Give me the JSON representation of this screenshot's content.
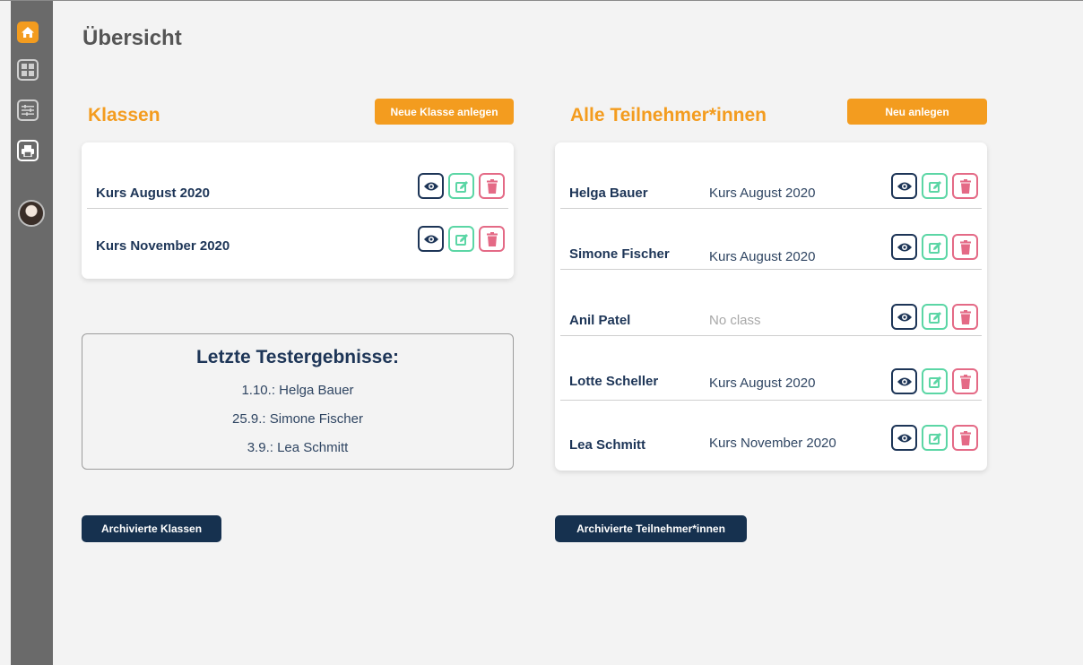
{
  "page": {
    "title": "Übersicht"
  },
  "sidebar": {
    "items": [
      {
        "icon": "home-icon",
        "active": true
      },
      {
        "icon": "dashboard-grid-icon",
        "active": false
      },
      {
        "icon": "settings-sliders-icon",
        "active": false
      },
      {
        "icon": "printer-icon",
        "active": false
      }
    ],
    "avatar_icon": "user-avatar"
  },
  "classes": {
    "title": "Klassen",
    "new_button": "Neue Klasse anlegen",
    "items": [
      {
        "name": "Kurs August 2020"
      },
      {
        "name": "Kurs November 2020"
      }
    ],
    "archive_button": "Archivierte Klassen"
  },
  "participants": {
    "title": "Alle Teilnehmer*innen",
    "new_button": "Neu anlegen",
    "items": [
      {
        "name": "Helga Bauer",
        "course": "Kurs August 2020"
      },
      {
        "name": "Simone Fischer",
        "course": "Kurs August 2020"
      },
      {
        "name": "Anil Patel",
        "course": "No class"
      },
      {
        "name": "Lotte Scheller",
        "course": "Kurs August 2020"
      },
      {
        "name": "Lea Schmitt",
        "course": "Kurs November 2020"
      }
    ],
    "archive_button": "Archivierte Teilnehmer*innen"
  },
  "results": {
    "title": "Letzte Testergebnisse:",
    "entries": [
      "1.10.: Helga Bauer",
      "25.9.: Simone Fischer",
      "3.9.: Lea Schmitt"
    ]
  },
  "colors": {
    "accent": "#f39c1f",
    "navy": "#1d3557",
    "edit": "#5bd6a5",
    "delete": "#e46a86",
    "sidebar": "#6a6a6a"
  }
}
